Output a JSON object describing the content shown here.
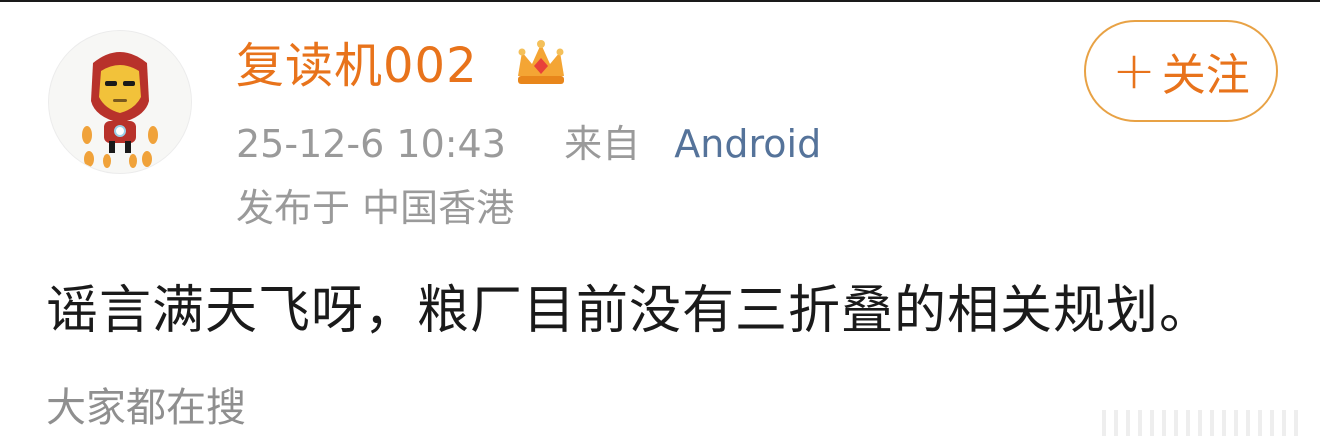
{
  "post": {
    "username": "复读机002",
    "badge_icon": "crown-badge-icon",
    "follow_label": "关注",
    "follow_plus": "+",
    "timestamp": "25-12-6 10:43",
    "from_label": "来自",
    "source": "Android",
    "location": "发布于 中国香港",
    "content": "谣言满天飞呀，粮厂目前没有三折叠的相关规划。",
    "everyone_search": "大家都在搜"
  },
  "colors": {
    "username": "#e8731b",
    "follow_border": "#e8a245",
    "source": "#55739a",
    "meta": "#9a9a9a",
    "text": "#1a1a1a"
  }
}
